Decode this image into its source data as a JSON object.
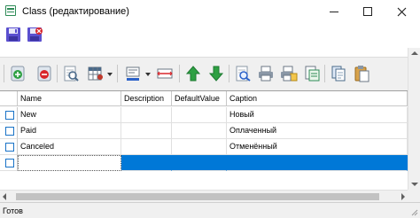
{
  "window": {
    "title": "Class (редактирование)"
  },
  "toolbar_top": {
    "buttons": [
      "save-icon",
      "save-close-icon"
    ]
  },
  "toolbar_main": {
    "buttons": [
      "add-record-icon",
      "delete-record-icon",
      "preview-icon",
      "table-settings-icon",
      "format-icon",
      "column-width-icon",
      "move-up-icon",
      "move-down-icon",
      "find-icon",
      "print-icon",
      "print-preview-icon",
      "export-icon",
      "copy-icon",
      "paste-icon"
    ]
  },
  "grid": {
    "columns": [
      "Name",
      "Description",
      "DefaultValue",
      "Caption"
    ],
    "rows": [
      {
        "name": "New",
        "description": "",
        "default_value": "",
        "caption": "Новый"
      },
      {
        "name": "Paid",
        "description": "",
        "default_value": "",
        "caption": "Оплаченный"
      },
      {
        "name": "Canceled",
        "description": "",
        "default_value": "",
        "caption": "Отменённый"
      },
      {
        "name": "",
        "description": "",
        "default_value": "",
        "caption": ""
      }
    ],
    "selection_color": "#0078d7",
    "checkbox_color": "#1a73c7"
  },
  "status": {
    "text": "Готов"
  }
}
